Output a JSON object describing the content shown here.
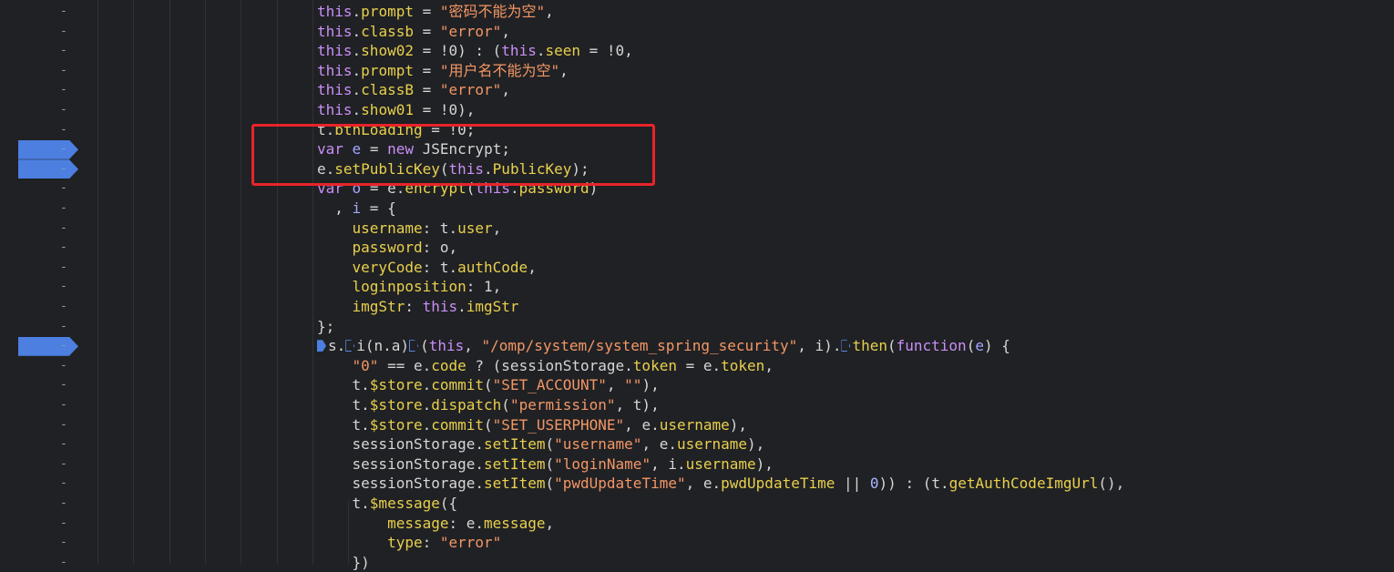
{
  "gutter": {
    "dash": "-",
    "breakpoint_lines": [
      7,
      8,
      17
    ]
  },
  "code": {
    "lines": [
      [
        {
          "c": "kw",
          "t": "this"
        },
        {
          "c": "plain",
          "t": "."
        },
        {
          "c": "prop",
          "t": "prompt"
        },
        {
          "c": "plain",
          "t": " = "
        },
        {
          "c": "str",
          "t": "\"密码不能为空\""
        },
        {
          "c": "plain",
          "t": ","
        }
      ],
      [
        {
          "c": "kw",
          "t": "this"
        },
        {
          "c": "plain",
          "t": "."
        },
        {
          "c": "prop",
          "t": "classb"
        },
        {
          "c": "plain",
          "t": " = "
        },
        {
          "c": "str",
          "t": "\"error\""
        },
        {
          "c": "plain",
          "t": ","
        }
      ],
      [
        {
          "c": "kw",
          "t": "this"
        },
        {
          "c": "plain",
          "t": "."
        },
        {
          "c": "prop",
          "t": "show02"
        },
        {
          "c": "plain",
          "t": " = !0) : ("
        },
        {
          "c": "kw",
          "t": "this"
        },
        {
          "c": "plain",
          "t": "."
        },
        {
          "c": "prop",
          "t": "seen"
        },
        {
          "c": "plain",
          "t": " = !0,"
        }
      ],
      [
        {
          "c": "kw",
          "t": "this"
        },
        {
          "c": "plain",
          "t": "."
        },
        {
          "c": "prop",
          "t": "prompt"
        },
        {
          "c": "plain",
          "t": " = "
        },
        {
          "c": "str",
          "t": "\"用户名不能为空\""
        },
        {
          "c": "plain",
          "t": ","
        }
      ],
      [
        {
          "c": "kw",
          "t": "this"
        },
        {
          "c": "plain",
          "t": "."
        },
        {
          "c": "prop",
          "t": "classB"
        },
        {
          "c": "plain",
          "t": " = "
        },
        {
          "c": "str",
          "t": "\"error\""
        },
        {
          "c": "plain",
          "t": ","
        }
      ],
      [
        {
          "c": "kw",
          "t": "this"
        },
        {
          "c": "plain",
          "t": "."
        },
        {
          "c": "prop",
          "t": "show01"
        },
        {
          "c": "plain",
          "t": " = !0),"
        }
      ],
      [
        {
          "c": "plain",
          "t": "t."
        },
        {
          "c": "prop",
          "t": "btnLoading"
        },
        {
          "c": "plain",
          "t": " = !0;"
        }
      ],
      [
        {
          "c": "kw",
          "t": "var"
        },
        {
          "c": "plain",
          "t": " "
        },
        {
          "c": "var",
          "t": "e"
        },
        {
          "c": "plain",
          "t": " = "
        },
        {
          "c": "kw",
          "t": "new"
        },
        {
          "c": "plain",
          "t": " JSEncrypt;"
        }
      ],
      [
        {
          "c": "plain",
          "t": "e."
        },
        {
          "c": "fn",
          "t": "setPublicKey"
        },
        {
          "c": "plain",
          "t": "("
        },
        {
          "c": "kw",
          "t": "this"
        },
        {
          "c": "plain",
          "t": "."
        },
        {
          "c": "prop",
          "t": "PublicKey"
        },
        {
          "c": "plain",
          "t": ");"
        }
      ],
      [
        {
          "c": "kw",
          "t": "var"
        },
        {
          "c": "plain",
          "t": " "
        },
        {
          "c": "var",
          "t": "o"
        },
        {
          "c": "plain",
          "t": " = e."
        },
        {
          "c": "fn",
          "t": "encrypt"
        },
        {
          "c": "plain",
          "t": "("
        },
        {
          "c": "kw",
          "t": "this"
        },
        {
          "c": "plain",
          "t": "."
        },
        {
          "c": "prop",
          "t": "password"
        },
        {
          "c": "plain",
          "t": ")"
        }
      ],
      [
        {
          "c": "plain",
          "t": "  , "
        },
        {
          "c": "var",
          "t": "i"
        },
        {
          "c": "plain",
          "t": " = {"
        }
      ],
      [
        {
          "c": "plain",
          "t": "    "
        },
        {
          "c": "prop",
          "t": "username"
        },
        {
          "c": "plain",
          "t": ": t."
        },
        {
          "c": "prop",
          "t": "user"
        },
        {
          "c": "plain",
          "t": ","
        }
      ],
      [
        {
          "c": "plain",
          "t": "    "
        },
        {
          "c": "prop",
          "t": "password"
        },
        {
          "c": "plain",
          "t": ": o,"
        }
      ],
      [
        {
          "c": "plain",
          "t": "    "
        },
        {
          "c": "prop",
          "t": "veryCode"
        },
        {
          "c": "plain",
          "t": ": t."
        },
        {
          "c": "prop",
          "t": "authCode"
        },
        {
          "c": "plain",
          "t": ","
        }
      ],
      [
        {
          "c": "plain",
          "t": "    "
        },
        {
          "c": "prop",
          "t": "loginposition"
        },
        {
          "c": "plain",
          "t": ": 1,"
        }
      ],
      [
        {
          "c": "plain",
          "t": "    "
        },
        {
          "c": "prop",
          "t": "imgStr"
        },
        {
          "c": "plain",
          "t": ": "
        },
        {
          "c": "kw",
          "t": "this"
        },
        {
          "c": "plain",
          "t": "."
        },
        {
          "c": "prop",
          "t": "imgStr"
        }
      ],
      [
        {
          "c": "plain",
          "t": "};"
        }
      ],
      [
        {
          "c": "marker",
          "t": ""
        },
        {
          "c": "plain",
          "t": "s."
        },
        {
          "c": "hollow",
          "t": ""
        },
        {
          "c": "plain",
          "t": "i(n.a)"
        },
        {
          "c": "hollow",
          "t": ""
        },
        {
          "c": "plain",
          "t": "("
        },
        {
          "c": "kw",
          "t": "this"
        },
        {
          "c": "plain",
          "t": ", "
        },
        {
          "c": "str",
          "t": "\"/omp/system/system_spring_security\""
        },
        {
          "c": "plain",
          "t": ", i)."
        },
        {
          "c": "hollow",
          "t": ""
        },
        {
          "c": "fn",
          "t": "then"
        },
        {
          "c": "plain",
          "t": "("
        },
        {
          "c": "kw",
          "t": "function"
        },
        {
          "c": "plain",
          "t": "("
        },
        {
          "c": "var",
          "t": "e"
        },
        {
          "c": "plain",
          "t": ") {"
        }
      ],
      [
        {
          "c": "plain",
          "t": "    "
        },
        {
          "c": "str",
          "t": "\"0\""
        },
        {
          "c": "plain",
          "t": " == e."
        },
        {
          "c": "prop",
          "t": "code"
        },
        {
          "c": "plain",
          "t": " ? (sessionStorage."
        },
        {
          "c": "prop",
          "t": "token"
        },
        {
          "c": "plain",
          "t": " = e."
        },
        {
          "c": "prop",
          "t": "token"
        },
        {
          "c": "plain",
          "t": ","
        }
      ],
      [
        {
          "c": "plain",
          "t": "    t."
        },
        {
          "c": "prop",
          "t": "$store"
        },
        {
          "c": "plain",
          "t": "."
        },
        {
          "c": "fn",
          "t": "commit"
        },
        {
          "c": "plain",
          "t": "("
        },
        {
          "c": "str",
          "t": "\"SET_ACCOUNT\""
        },
        {
          "c": "plain",
          "t": ", "
        },
        {
          "c": "str",
          "t": "\"\""
        },
        {
          "c": "plain",
          "t": "),"
        }
      ],
      [
        {
          "c": "plain",
          "t": "    t."
        },
        {
          "c": "prop",
          "t": "$store"
        },
        {
          "c": "plain",
          "t": "."
        },
        {
          "c": "fn",
          "t": "dispatch"
        },
        {
          "c": "plain",
          "t": "("
        },
        {
          "c": "str",
          "t": "\"permission\""
        },
        {
          "c": "plain",
          "t": ", t),"
        }
      ],
      [
        {
          "c": "plain",
          "t": "    t."
        },
        {
          "c": "prop",
          "t": "$store"
        },
        {
          "c": "plain",
          "t": "."
        },
        {
          "c": "fn",
          "t": "commit"
        },
        {
          "c": "plain",
          "t": "("
        },
        {
          "c": "str",
          "t": "\"SET_USERPHONE\""
        },
        {
          "c": "plain",
          "t": ", e."
        },
        {
          "c": "prop",
          "t": "username"
        },
        {
          "c": "plain",
          "t": "),"
        }
      ],
      [
        {
          "c": "plain",
          "t": "    sessionStorage."
        },
        {
          "c": "fn",
          "t": "setItem"
        },
        {
          "c": "plain",
          "t": "("
        },
        {
          "c": "str",
          "t": "\"username\""
        },
        {
          "c": "plain",
          "t": ", e."
        },
        {
          "c": "prop",
          "t": "username"
        },
        {
          "c": "plain",
          "t": "),"
        }
      ],
      [
        {
          "c": "plain",
          "t": "    sessionStorage."
        },
        {
          "c": "fn",
          "t": "setItem"
        },
        {
          "c": "plain",
          "t": "("
        },
        {
          "c": "str",
          "t": "\"loginName\""
        },
        {
          "c": "plain",
          "t": ", i."
        },
        {
          "c": "prop",
          "t": "username"
        },
        {
          "c": "plain",
          "t": "),"
        }
      ],
      [
        {
          "c": "plain",
          "t": "    sessionStorage."
        },
        {
          "c": "fn",
          "t": "setItem"
        },
        {
          "c": "plain",
          "t": "("
        },
        {
          "c": "str",
          "t": "\"pwdUpdateTime\""
        },
        {
          "c": "plain",
          "t": ", e."
        },
        {
          "c": "prop",
          "t": "pwdUpdateTime"
        },
        {
          "c": "plain",
          "t": " || "
        },
        {
          "c": "num",
          "t": "0"
        },
        {
          "c": "plain",
          "t": ")) : (t."
        },
        {
          "c": "fn",
          "t": "getAuthCodeImgUrl"
        },
        {
          "c": "plain",
          "t": "(),"
        }
      ],
      [
        {
          "c": "plain",
          "t": "    t."
        },
        {
          "c": "fn",
          "t": "$message"
        },
        {
          "c": "plain",
          "t": "({"
        }
      ],
      [
        {
          "c": "plain",
          "t": "        "
        },
        {
          "c": "prop",
          "t": "message"
        },
        {
          "c": "plain",
          "t": ": e."
        },
        {
          "c": "prop",
          "t": "message"
        },
        {
          "c": "plain",
          "t": ","
        }
      ],
      [
        {
          "c": "plain",
          "t": "        "
        },
        {
          "c": "prop",
          "t": "type"
        },
        {
          "c": "plain",
          "t": ": "
        },
        {
          "c": "str",
          "t": "\"error\""
        }
      ],
      [
        {
          "c": "plain",
          "t": "    })"
        }
      ]
    ]
  },
  "colors": {
    "background": "#202124",
    "breakpoint": "#4c7fe0",
    "highlight_box": "#e8242a"
  }
}
